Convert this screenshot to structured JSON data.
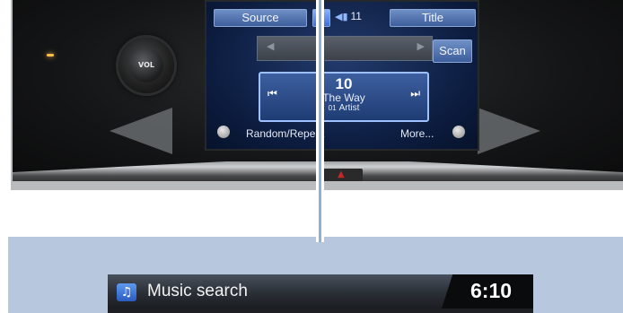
{
  "head_unit": {
    "knob_label": "VOL",
    "hazard_symbol": "▲",
    "screen": {
      "source_label": "Source",
      "volume": "11",
      "title_label": "Title",
      "scan_label": "Scan",
      "track": {
        "number": "10",
        "title": "The Way",
        "artist_prefix": "01",
        "artist": "Artist"
      },
      "random_repeat_label": "Random/Repeat",
      "more_label": "More..."
    }
  },
  "music_search_bar": {
    "title": "Music search",
    "time": "6:10"
  },
  "colors": {
    "panel_bg": "#b6c7de",
    "screen_blue": "#1f3c74",
    "connector": "#8fb0d4"
  }
}
